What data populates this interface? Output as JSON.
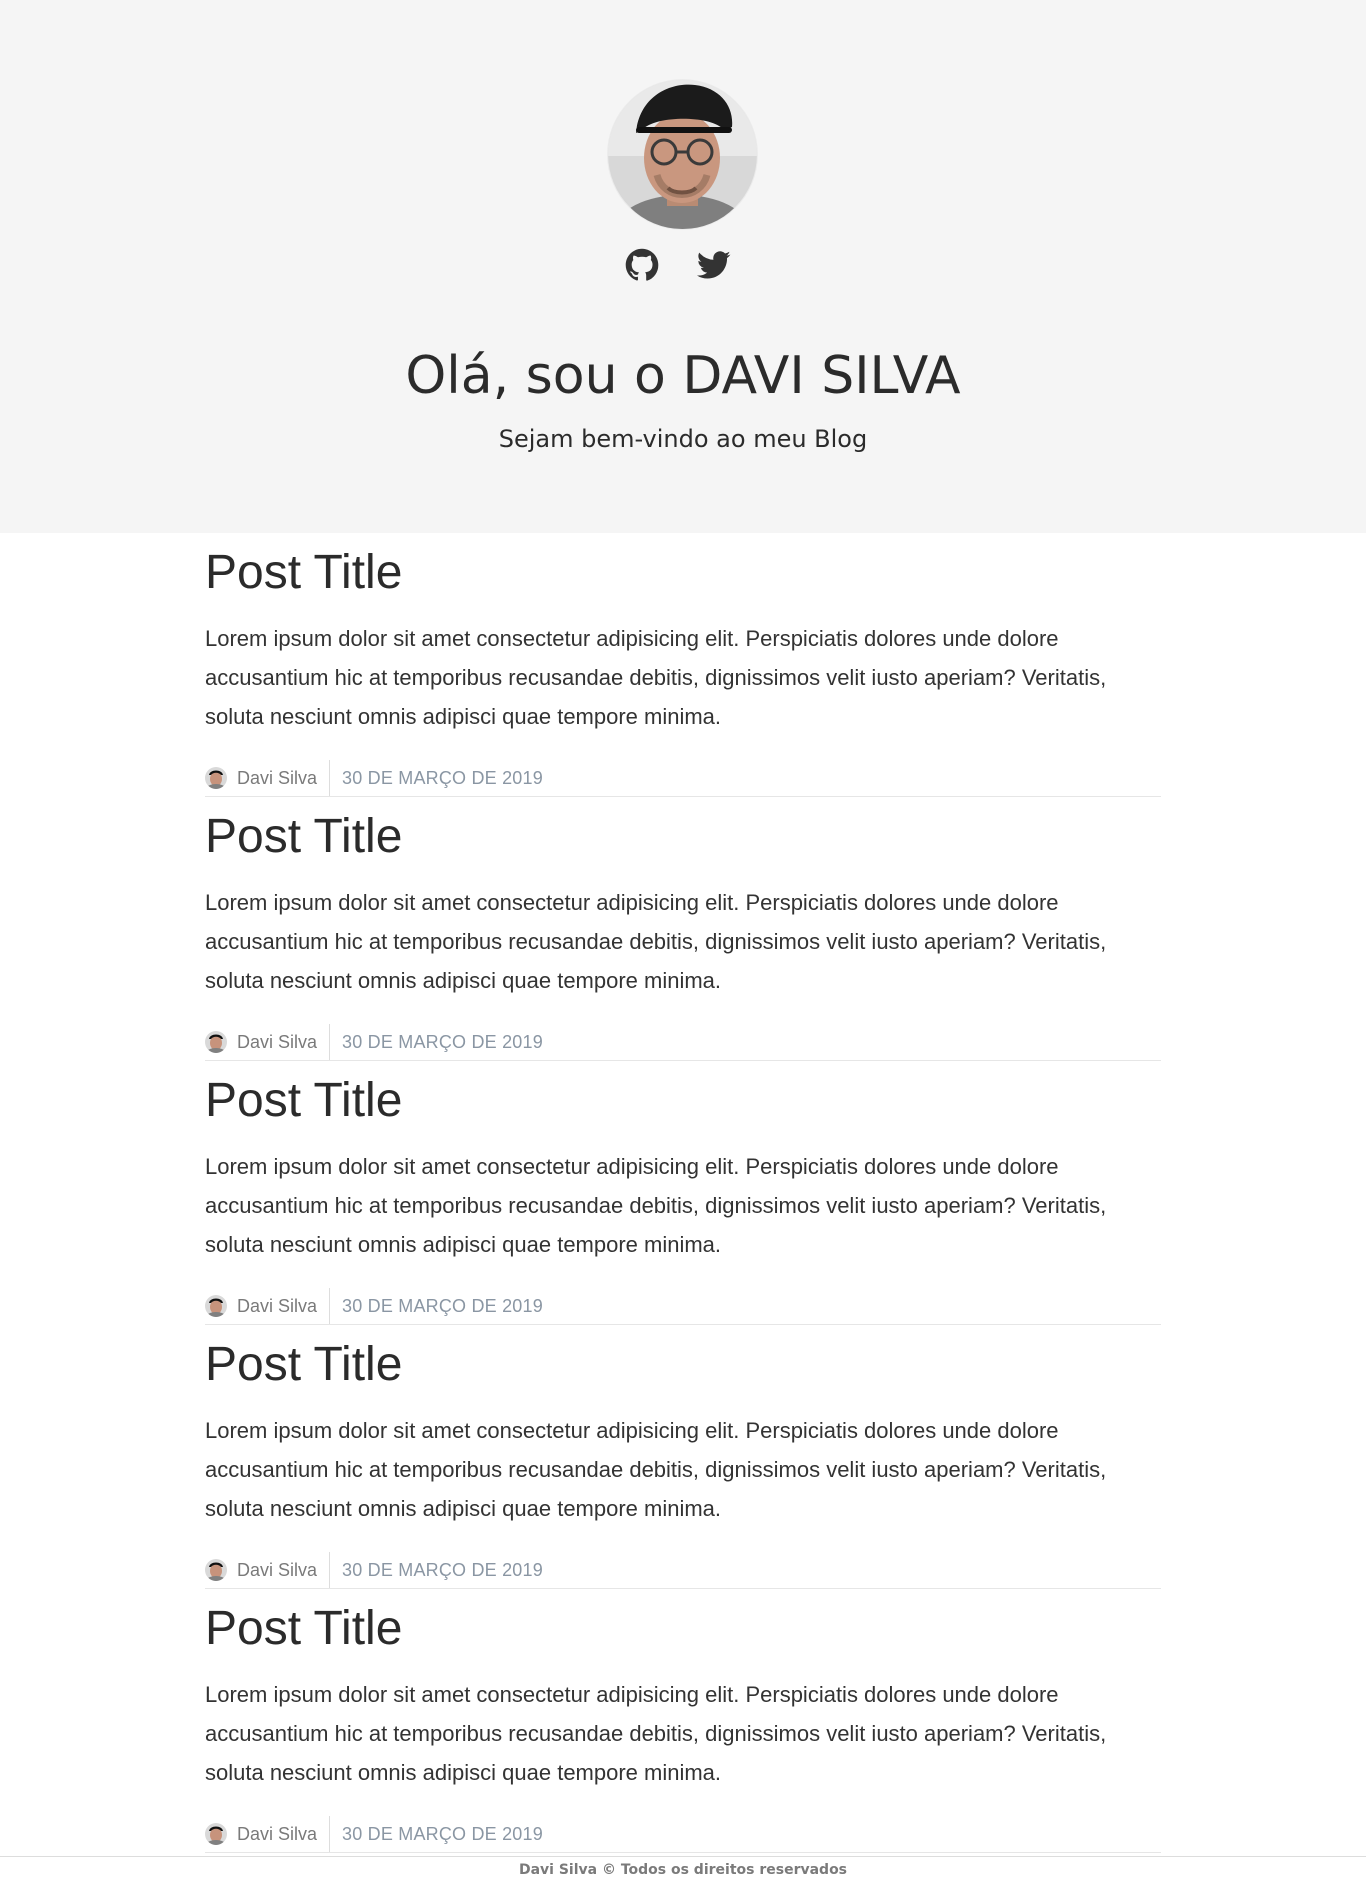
{
  "hero": {
    "title": "Olá, sou o DAVI SILVA",
    "subtitle": "Sejam bem-vindo ao meu Blog",
    "social_links": [
      {
        "icon": "github-icon"
      },
      {
        "icon": "twitter-icon"
      }
    ]
  },
  "posts": [
    {
      "title": "Post Title",
      "excerpt": "Lorem ipsum dolor sit amet consectetur adipisicing elit. Perspiciatis dolores unde dolore accusantium hic at temporibus recusandae debitis, dignissimos velit iusto aperiam? Veritatis, soluta nesciunt omnis adipisci quae tempore minima.",
      "author": "Davi Silva",
      "date": "30 DE MARÇO DE 2019"
    },
    {
      "title": "Post Title",
      "excerpt": "Lorem ipsum dolor sit amet consectetur adipisicing elit. Perspiciatis dolores unde dolore accusantium hic at temporibus recusandae debitis, dignissimos velit iusto aperiam? Veritatis, soluta nesciunt omnis adipisci quae tempore minima.",
      "author": "Davi Silva",
      "date": "30 DE MARÇO DE 2019"
    },
    {
      "title": "Post Title",
      "excerpt": "Lorem ipsum dolor sit amet consectetur adipisicing elit. Perspiciatis dolores unde dolore accusantium hic at temporibus recusandae debitis, dignissimos velit iusto aperiam? Veritatis, soluta nesciunt omnis adipisci quae tempore minima.",
      "author": "Davi Silva",
      "date": "30 DE MARÇO DE 2019"
    },
    {
      "title": "Post Title",
      "excerpt": "Lorem ipsum dolor sit amet consectetur adipisicing elit. Perspiciatis dolores unde dolore accusantium hic at temporibus recusandae debitis, dignissimos velit iusto aperiam? Veritatis, soluta nesciunt omnis adipisci quae tempore minima.",
      "author": "Davi Silva",
      "date": "30 DE MARÇO DE 2019"
    },
    {
      "title": "Post Title",
      "excerpt": "Lorem ipsum dolor sit amet consectetur adipisicing elit. Perspiciatis dolores unde dolore accusantium hic at temporibus recusandae debitis, dignissimos velit iusto aperiam? Veritatis, soluta nesciunt omnis adipisci quae tempore minima.",
      "author": "Davi Silva",
      "date": "30 DE MARÇO DE 2019"
    }
  ],
  "footer": {
    "text": "Davi Silva © Todos os direitos reservados"
  },
  "colors": {
    "hero_background": "#f5f5f5",
    "text": "#2b2b2b",
    "meta_date": "#8a96a3"
  }
}
